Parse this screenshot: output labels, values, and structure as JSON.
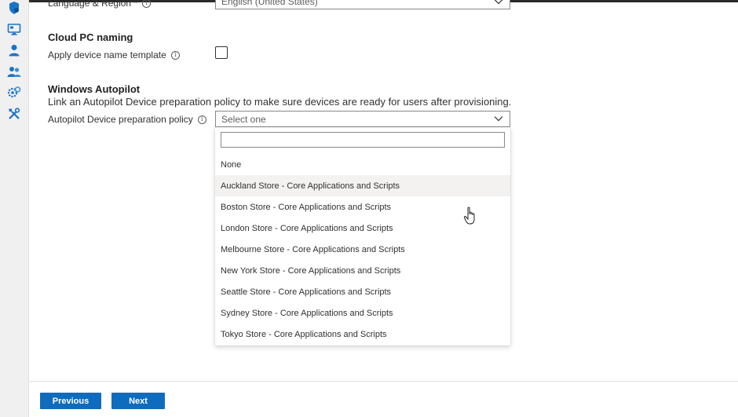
{
  "sidebar": {
    "icons": [
      {
        "name": "shield-icon"
      },
      {
        "name": "monitor-icon"
      },
      {
        "name": "user-icon"
      },
      {
        "name": "users-icon"
      },
      {
        "name": "settings-gear-icon"
      },
      {
        "name": "tools-icon"
      }
    ]
  },
  "language_region": {
    "label": "Language & Region *",
    "value": "English (United States)"
  },
  "cloud_pc_naming": {
    "title": "Cloud PC naming",
    "apply_template_label": "Apply device name template",
    "checked": false
  },
  "windows_autopilot": {
    "title": "Windows Autopilot",
    "description": "Link an Autopilot Device preparation policy to make sure devices are ready for users after provisioning.",
    "policy_label": "Autopilot Device preparation policy",
    "policy_placeholder": "Select one",
    "search_value": "",
    "options": [
      "None",
      "Auckland Store - Core Applications and Scripts",
      "Boston Store - Core Applications and Scripts",
      "London Store - Core Applications and Scripts",
      "Melbourne Store - Core Applications and Scripts",
      "New York Store - Core Applications and Scripts",
      "Seattle Store - Core Applications and Scripts",
      "Sydney Store - Core Applications and Scripts",
      "Tokyo Store - Core Applications and Scripts"
    ],
    "hovered_option": "Auckland Store - Core Applications and Scripts"
  },
  "footer": {
    "previous_label": "Previous",
    "next_label": "Next"
  },
  "colors": {
    "primary": "#0f6cbd",
    "icon_blue": "#1a73c8"
  }
}
